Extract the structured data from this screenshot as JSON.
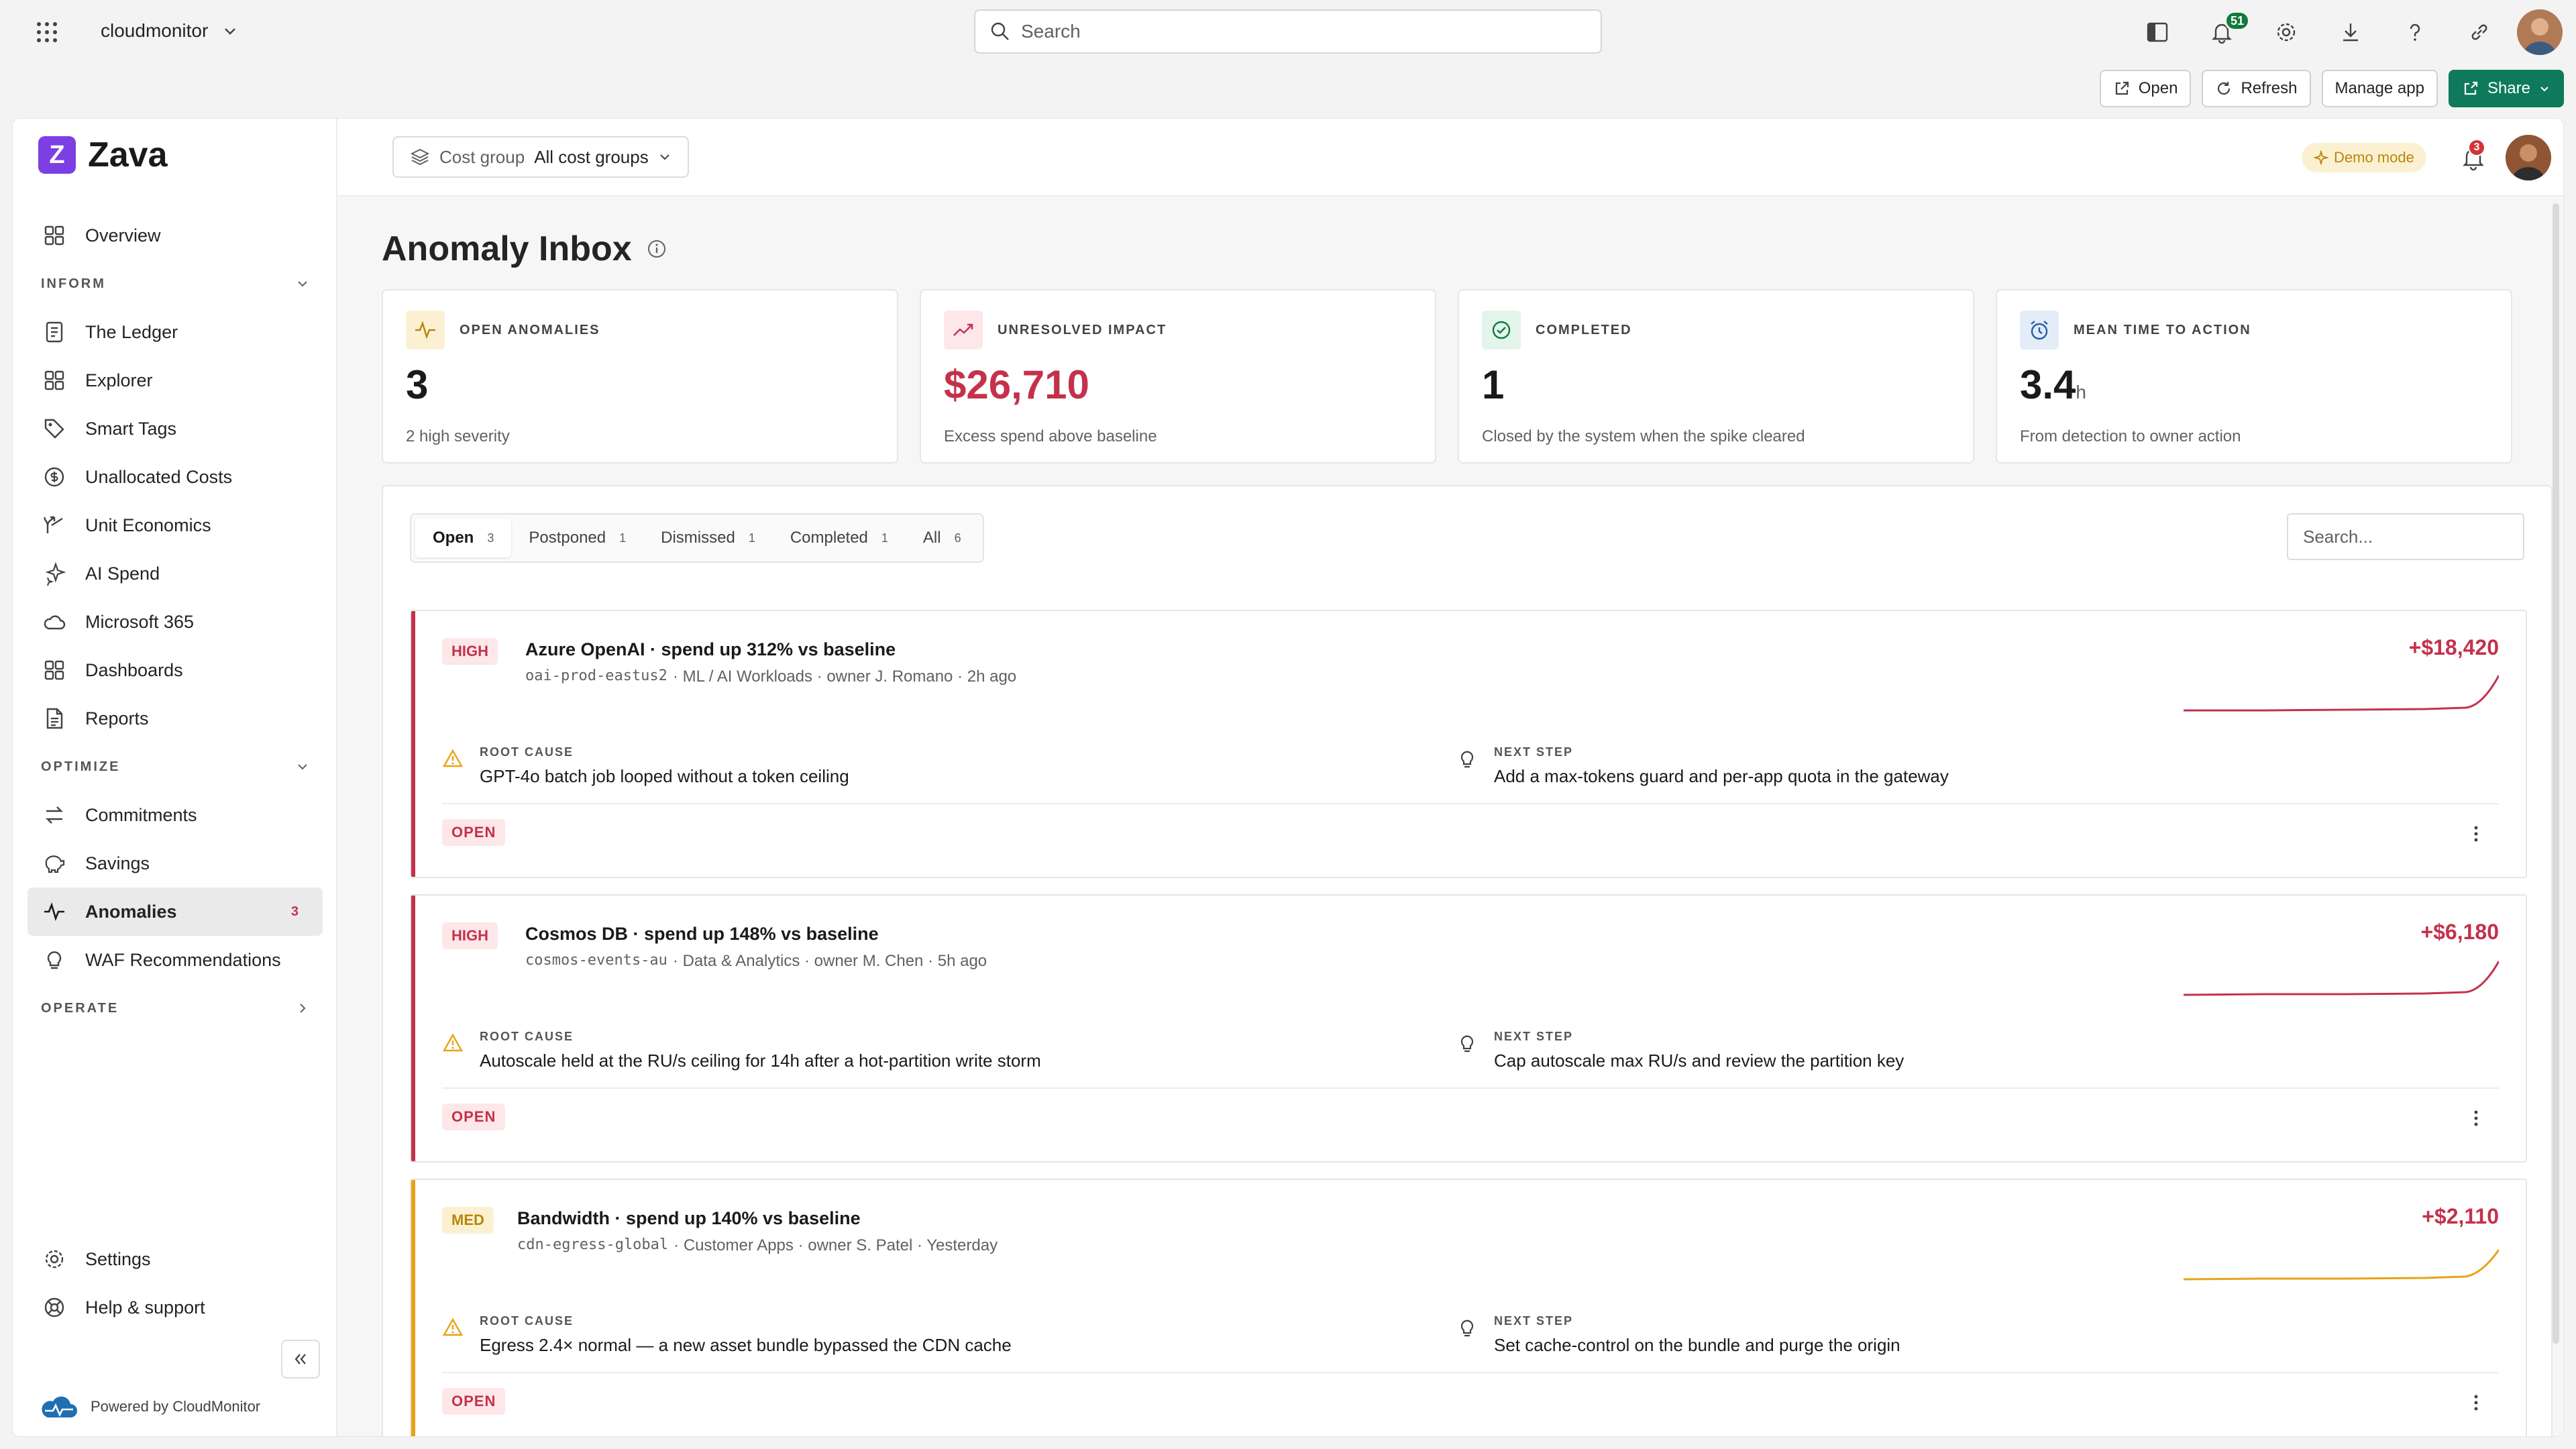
{
  "topbar": {
    "app_name": "cloudmonitor",
    "search_placeholder": "Search",
    "notif_count": "51"
  },
  "commands": {
    "open": "Open",
    "refresh": "Refresh",
    "manage": "Manage app",
    "share": "Share"
  },
  "brand": {
    "logo_letter": "Z",
    "name": "Zava",
    "powered": "Powered by CloudMonitor"
  },
  "header": {
    "cost_group_label": "Cost group",
    "cost_group_value": "All cost groups",
    "demo_mode": "Demo mode",
    "bell_count": "3"
  },
  "sidebar": {
    "overview": "Overview",
    "inform": "INFORM",
    "inform_items": [
      "The Ledger",
      "Explorer",
      "Smart Tags",
      "Unallocated Costs",
      "Unit Economics",
      "AI Spend",
      "Microsoft 365",
      "Dashboards",
      "Reports"
    ],
    "optimize": "OPTIMIZE",
    "optimize_items": [
      "Commitments",
      "Savings",
      "Anomalies",
      "WAF Recommendations"
    ],
    "anomalies_badge": "3",
    "operate": "OPERATE",
    "settings": "Settings",
    "help": "Help & support"
  },
  "page": {
    "title": "Anomaly Inbox"
  },
  "kpis": [
    {
      "label": "OPEN ANOMALIES",
      "value": "3",
      "unit": "",
      "sub": "2 high severity"
    },
    {
      "label": "UNRESOLVED IMPACT",
      "value": "$26,710",
      "unit": "",
      "sub": "Excess spend above baseline"
    },
    {
      "label": "COMPLETED",
      "value": "1",
      "unit": "",
      "sub": "Closed by the system when the spike cleared"
    },
    {
      "label": "MEAN TIME TO ACTION",
      "value": "3.4",
      "unit": "h",
      "sub": "From detection to owner action"
    }
  ],
  "tabs": [
    {
      "label": "Open",
      "count": "3"
    },
    {
      "label": "Postponed",
      "count": "1"
    },
    {
      "label": "Dismissed",
      "count": "1"
    },
    {
      "label": "Completed",
      "count": "1"
    },
    {
      "label": "All",
      "count": "6"
    }
  ],
  "panel_search_placeholder": "Search...",
  "labels": {
    "root_cause": "ROOT CAUSE",
    "next_step": "NEXT STEP"
  },
  "anomalies": [
    {
      "severity": "HIGH",
      "title": "Azure OpenAI · spend up 312% vs baseline",
      "resource": "oai-prod-eastus2",
      "meta": "· ML / AI Workloads · owner J. Romano · 2h ago",
      "amount": "+$18,420",
      "root_cause": "GPT-4o batch job looped without a token ceiling",
      "next_step": "Add a max-tokens guard and per-app quota in the gateway",
      "status": "OPEN",
      "color": "#c4314b"
    },
    {
      "severity": "HIGH",
      "title": "Cosmos DB · spend up 148% vs baseline",
      "resource": "cosmos-events-au",
      "meta": "· Data & Analytics · owner M. Chen · 5h ago",
      "amount": "+$6,180",
      "root_cause": "Autoscale held at the RU/s ceiling for 14h after a hot-partition write storm",
      "next_step": "Cap autoscale max RU/s and review the partition key",
      "status": "OPEN",
      "color": "#c4314b"
    },
    {
      "severity": "MED",
      "title": "Bandwidth · spend up 140% vs baseline",
      "resource": "cdn-egress-global",
      "meta": "· Customer Apps · owner S. Patel · Yesterday",
      "amount": "+$2,110",
      "root_cause": "Egress 2.4× normal — a new asset bundle bypassed the CDN cache",
      "next_step": "Set cache-control on the bundle and purge the origin",
      "status": "OPEN",
      "color": "#e8a317"
    }
  ]
}
